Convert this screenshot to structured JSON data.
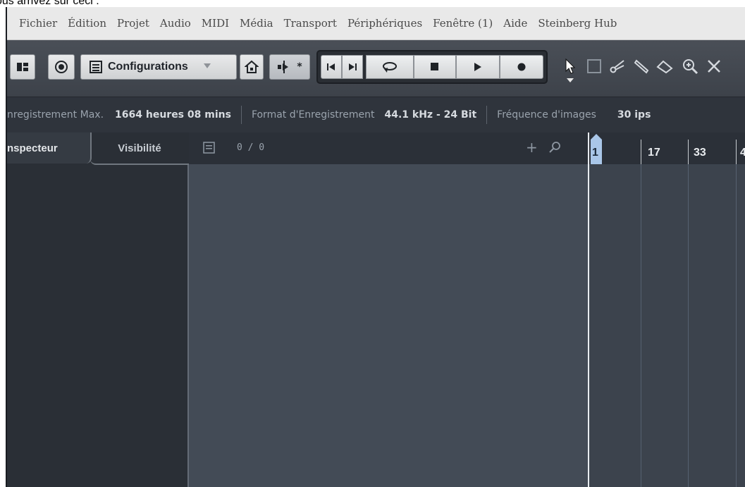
{
  "caption": "ous arrivez sur ceci :",
  "menu": [
    "Fichier",
    "Édition",
    "Projet",
    "Audio",
    "MIDI",
    "Média",
    "Transport",
    "Périphériques",
    "Fenêtre (1)",
    "Aide",
    "Steinberg Hub"
  ],
  "toolbar": {
    "configurations_label": "Configurations",
    "icons": [
      "inspector-toggle-icon",
      "constrain-delay-icon",
      "configurations-list-icon",
      "home-icon",
      "auto-scroll-icon",
      "go-to-start-icon",
      "go-to-end-icon",
      "cycle-icon",
      "stop-icon",
      "play-icon",
      "record-icon",
      "object-selection-icon",
      "range-selection-icon",
      "split-icon",
      "glue-icon",
      "erase-icon",
      "zoom-icon",
      "mute-icon"
    ],
    "marker_symbol": "*"
  },
  "status": {
    "rec_max_label": "nregistrement Max.",
    "rec_max_value": "1664 heures 08 mins",
    "format_label": "Format d'Enregistrement",
    "format_value": "44.1 kHz - 24 Bit",
    "framerate_label": "Fréquence d'images",
    "framerate_value": "30 ips"
  },
  "inspector": {
    "tab_inspector": "nspecteur",
    "tab_visibility": "Visibilité"
  },
  "tracklist": {
    "count": "0 / 0",
    "add_symbol": "+"
  },
  "ruler": {
    "bars": [
      "1",
      "17",
      "33",
      "4"
    ]
  },
  "colors": {
    "menu_bg": "#e9e9e9",
    "panel_bg": "#2b3038",
    "tracklist_bg": "#434b56",
    "playhead": "#a9c6e8"
  }
}
